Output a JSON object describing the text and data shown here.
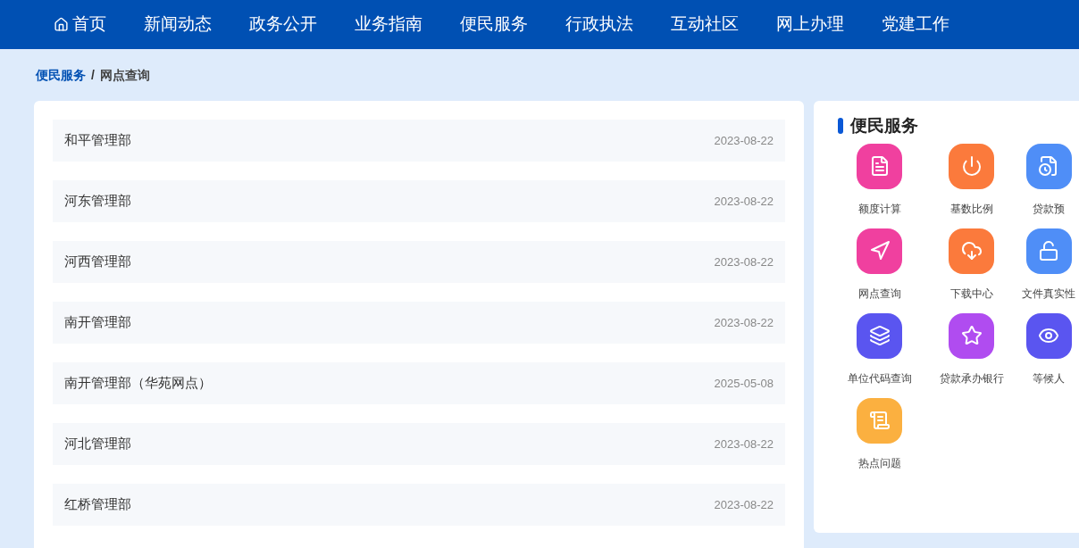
{
  "nav": {
    "items": [
      {
        "label": "首页",
        "selected": false,
        "kind": "home"
      },
      {
        "label": "新闻动态",
        "selected": false
      },
      {
        "label": "政务公开",
        "selected": false
      },
      {
        "label": "业务指南",
        "selected": false
      },
      {
        "label": "便民服务",
        "selected": false
      },
      {
        "label": "行政执法",
        "selected": false
      },
      {
        "label": "互动社区",
        "selected": false
      },
      {
        "label": "网上办理",
        "selected": false
      },
      {
        "label": "党建工作",
        "selected": false
      }
    ]
  },
  "breadcrumb": {
    "parent": "便民服务",
    "separator": "/",
    "current": "网点查询"
  },
  "list": [
    {
      "name": "和平管理部",
      "date": "2023-08-22"
    },
    {
      "name": "河东管理部",
      "date": "2023-08-22"
    },
    {
      "name": "河西管理部",
      "date": "2023-08-22"
    },
    {
      "name": "南开管理部",
      "date": "2023-08-22"
    },
    {
      "name": "南开管理部（华苑网点）",
      "date": "2025-05-08"
    },
    {
      "name": "河北管理部",
      "date": "2023-08-22"
    },
    {
      "name": "红桥管理部",
      "date": "2023-08-22"
    }
  ],
  "services": {
    "title": "便民服务",
    "items": [
      {
        "label": "额度计算",
        "kind": "document",
        "color": "#f0409f"
      },
      {
        "label": "基数比例",
        "kind": "power",
        "color": "#fb7a3c"
      },
      {
        "label": "贷款预",
        "kind": "clock-doc",
        "color": "#4f8ef7"
      },
      {
        "label": "网点查询",
        "kind": "navigation",
        "color": "#f0409f"
      },
      {
        "label": "下载中心",
        "kind": "cloud",
        "color": "#fb7a3c"
      },
      {
        "label": "文件真实性",
        "kind": "lock",
        "color": "#4f8ef7"
      },
      {
        "label": "单位代码查询",
        "kind": "layers",
        "color": "#5a55f0"
      },
      {
        "label": "贷款承办银行",
        "kind": "star",
        "color": "#b04cf0"
      },
      {
        "label": "等候人",
        "kind": "eye",
        "color": "#5a55f0"
      },
      {
        "label": "热点问题",
        "kind": "list",
        "color": "#fbb040"
      }
    ]
  }
}
